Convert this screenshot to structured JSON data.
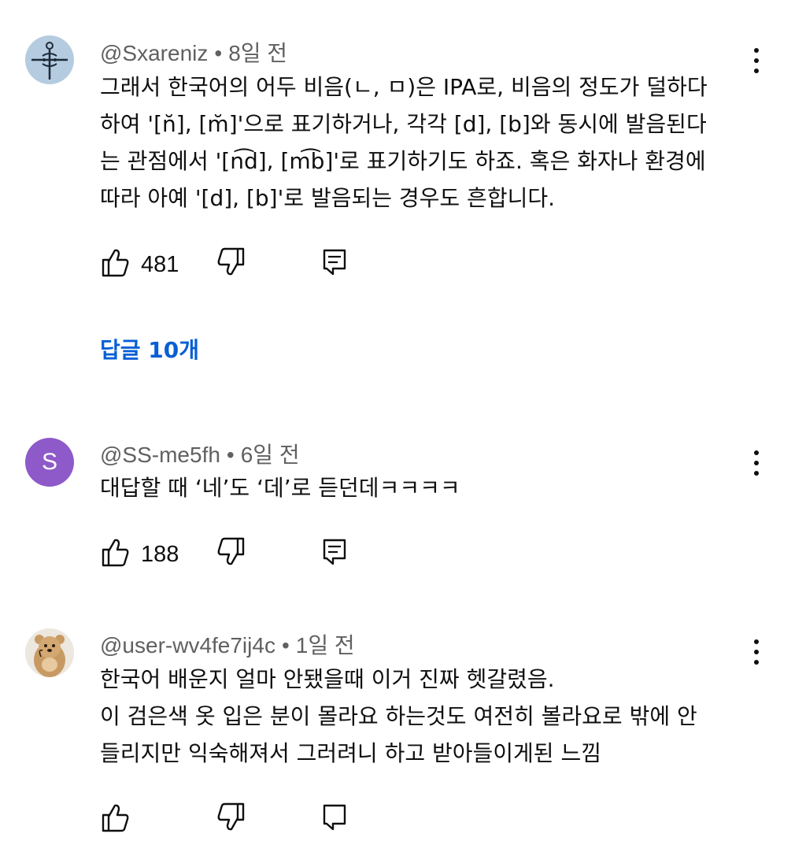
{
  "comments": [
    {
      "handle": "@Sxareniz",
      "time": "8일 전",
      "avatar_icon": "emblem-avatar",
      "lines": [
        "그래서 한국어의 어두 비음(ㄴ, ㅁ)은 IPA로, 비음의 정도가 덜하다",
        "하여 '[n̆], [m̆]'으로 표기하거나, 각각 [d], [b]와 동시에 발음된다",
        "는 관점에서 '[n͡d], [m͡b]'로 표기하기도 하죠. 혹은 화자나 환경에",
        "따라 아예 '[d], [b]'로 발음되는 경우도 흔합니다."
      ],
      "likes": "481",
      "replies_label": "답글 10개"
    },
    {
      "handle": "@SS-me5fh",
      "time": "6일 전",
      "avatar_letter": "S",
      "avatar_color": "#8e59c9",
      "lines": [
        "대답할 때 ‘네’도 ‘데’로 듣던데ㅋㅋㅋㅋ"
      ],
      "likes": "188"
    },
    {
      "handle": "@user-wv4fe7ij4c",
      "time": "1일 전",
      "avatar_icon": "quokka-avatar",
      "lines": [
        "한국어 배운지 얼마 안됐을때 이거 진짜 헷갈렸음.",
        "이 검은색 옷 입은 분이 몰라요 하는것도 여전히 볼라요로 밖에 안",
        "들리지만 익숙해져서 그러려니 하고 받아들이게된 느낌"
      ]
    }
  ],
  "colors": {
    "link": "#065fd4",
    "meta": "#606060",
    "text": "#0f0f0f"
  }
}
